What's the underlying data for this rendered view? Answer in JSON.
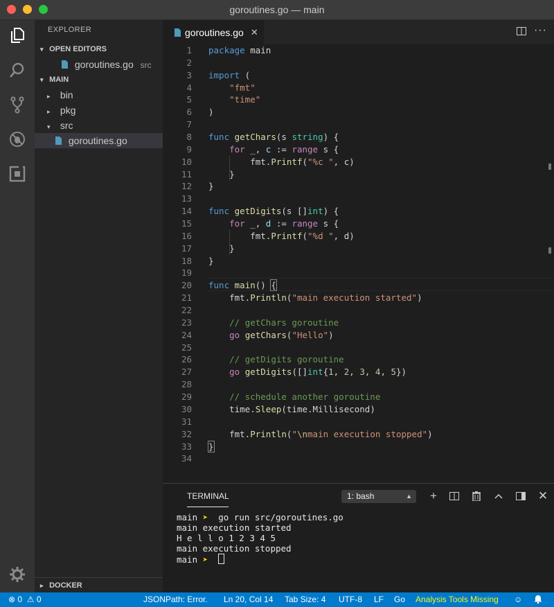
{
  "window": {
    "title": "goroutines.go — main"
  },
  "activity": {
    "icons": [
      "files-icon",
      "search-icon",
      "source-control-icon",
      "debug-icon",
      "extensions-icon",
      "gear-icon"
    ]
  },
  "sidebar": {
    "title": "EXPLORER",
    "open_editors_label": "OPEN EDITORS",
    "open_editor": {
      "name": "goroutines.go",
      "hint": "src"
    },
    "folder_label": "MAIN",
    "tree": [
      {
        "name": "bin",
        "caret": "▸"
      },
      {
        "name": "pkg",
        "caret": "▸"
      },
      {
        "name": "src",
        "caret": "▾"
      },
      {
        "name": "goroutines.go",
        "caret": ""
      }
    ],
    "docker_label": "DOCKER"
  },
  "tab": {
    "label": "goroutines.go",
    "close": "✕"
  },
  "editor": {
    "line_numbers": [
      "1",
      "2",
      "3",
      "4",
      "5",
      "6",
      "7",
      "8",
      "9",
      "10",
      "11",
      "12",
      "13",
      "14",
      "15",
      "16",
      "17",
      "18",
      "19",
      "20",
      "21",
      "22",
      "23",
      "24",
      "25",
      "26",
      "27",
      "28",
      "29",
      "30",
      "31",
      "32",
      "33",
      "34"
    ],
    "tokens": {
      "package": "package",
      "main": " main",
      "import": "import",
      "paren_open": " (",
      "fmt": "\"fmt\"",
      "time": "\"time\"",
      "paren_close": ")",
      "func": "func",
      "getChars": "getChars",
      "sig1a": "(s ",
      "string": "string",
      "sig1b": ") {",
      "for": "for",
      "loop1a": " _, ",
      "c": "c",
      "assign": " := ",
      "range": "range",
      "loop1b": " s {",
      "fmt_dot": "fmt.",
      "printf": "Printf",
      "lp": "(",
      "fmt_c": "\"%c \"",
      "arg_c": ", c)",
      "brace_close": "}",
      "getDigits": "getDigits",
      "sig2a": "(s []",
      "int": "int",
      "sig2b": ") {",
      "d": "d",
      "fmt_d": "\"%d \"",
      "arg_d": ", d)",
      "main_fn": "main",
      "main_sig": "() ",
      "brace_open": "{",
      "println": "Println",
      "str_started": "\"main execution started\"",
      "rp": ")",
      "cmt1": "// getChars goroutine",
      "go": "go",
      "str_hello": "\"Hello\"",
      "cmt2": "// getDigits goroutine",
      "slice_open": "([]",
      "slice_lit_open": "{",
      "n1": "1",
      "n2": "2",
      "n3": "3",
      "n4": "4",
      "n5": "5",
      "comma": ", ",
      "slice_end": "})",
      "cmt3": "// schedule another goroutine",
      "time_dot": "time.",
      "sleep": "Sleep",
      "sleep_arg": "(time.Millisecond)",
      "q": "\"",
      "esc_n": "\\n",
      "str_stopped": "main execution stopped\""
    }
  },
  "terminal": {
    "title": "TERMINAL",
    "shell_select": "1: bash",
    "lines": [
      {
        "prompt": "main",
        "arrow": " ➤ ",
        "cmd": " go run src/goroutines.go"
      },
      {
        "text": "main execution started"
      },
      {
        "text": "H e l l o 1 2 3 4 5"
      },
      {
        "text": "main execution stopped"
      },
      {
        "prompt": "main",
        "arrow": " ➤ ",
        "cmd": " "
      }
    ]
  },
  "statusbar": {
    "errors": "0",
    "warnings": "0",
    "jsonpath": "JSONPath: Error.",
    "position": "Ln 20, Col 14",
    "tab_size": "Tab Size: 4",
    "encoding": "UTF-8",
    "eol": "LF",
    "language": "Go",
    "analysis": "Analysis Tools Missing"
  },
  "colors": {
    "accent": "#007acc",
    "warning": "#f5f51e",
    "prompt_arrow": "#f5d600"
  }
}
